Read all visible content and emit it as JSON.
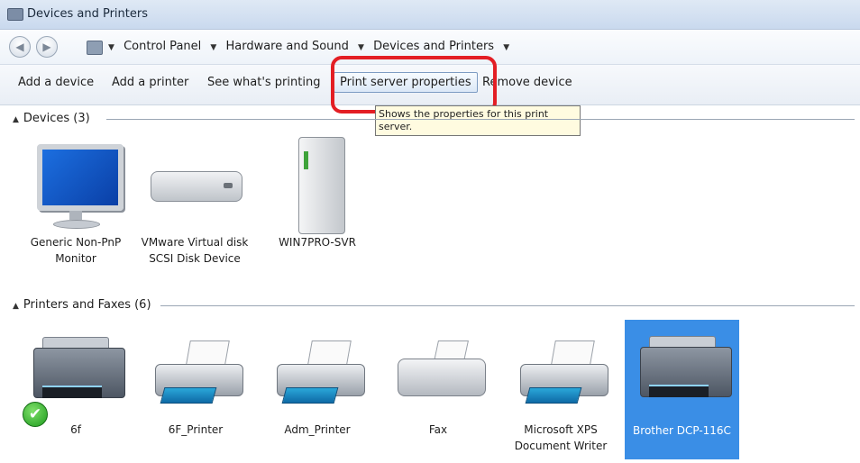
{
  "window": {
    "title": "Devices and Printers"
  },
  "address": {
    "back_glyph": "◀",
    "forward_glyph": "▶",
    "arrow_glyph": "▼",
    "crumbs": [
      "Control Panel",
      "Hardware and Sound",
      "Devices and Printers"
    ]
  },
  "toolbar": {
    "add_device": "Add a device",
    "add_printer": "Add a printer",
    "see_printing": "See what's printing",
    "print_server": "Print server properties",
    "remove_device": "Remove device"
  },
  "tooltip": {
    "text": "Shows the properties for this print server."
  },
  "accent": {
    "callout": "#e31e24",
    "selection": "#3a8ee6"
  },
  "groups": {
    "devices": {
      "header": "Devices (3)",
      "items": [
        {
          "label": "Generic Non-PnP Monitor",
          "icon": "monitor-icon"
        },
        {
          "label": "VMware Virtual disk SCSI Disk Device",
          "icon": "disk-drive-icon"
        },
        {
          "label": "WIN7PRO-SVR",
          "icon": "computer-tower-icon"
        }
      ]
    },
    "printers": {
      "header": "Printers and Faxes (6)",
      "items": [
        {
          "label": "6f",
          "icon": "multifunction-printer-icon",
          "default": true
        },
        {
          "label": "6F_Printer",
          "icon": "printer-icon"
        },
        {
          "label": "Adm_Printer",
          "icon": "printer-icon"
        },
        {
          "label": "Fax",
          "icon": "fax-icon"
        },
        {
          "label": "Microsoft XPS Document Writer",
          "icon": "printer-icon"
        },
        {
          "label": "Brother DCP-116C",
          "icon": "multifunction-printer-icon",
          "selected": true
        }
      ]
    }
  },
  "collapse_glyph": "▲",
  "default_check_glyph": "✔"
}
